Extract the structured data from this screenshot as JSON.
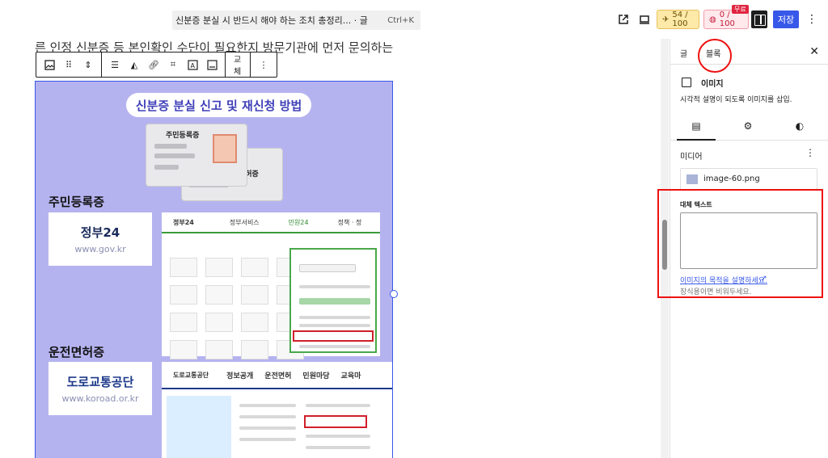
{
  "topbar": {
    "command_title": "신분증 분실 시 반드시 해야 하는 조치 총정리... · 글",
    "command_shortcut": "Ctrl+K",
    "seo_score": "54 / 100",
    "ai_count": "0 / 100",
    "free_badge": "무료",
    "save_label": "저장"
  },
  "editor": {
    "paragraph_text": "른 인정 신분증 등 본인확인 수단이 필요한지 방문기관에 먼저 문의하는",
    "toolbar_replace": "교체"
  },
  "image": {
    "title": "신분증 분실 신고 및 재신청 방법",
    "card_front_label": "주민등록증",
    "card_back_label": "면허증",
    "section1": "주민등록증",
    "gov_logo": "정부24",
    "gov_url": "www.gov.kr",
    "gov_site_logo": "정부24",
    "gov_nav": [
      "정부서비스",
      "민원24",
      "정책 · 정"
    ],
    "section2": "운전면허증",
    "koroad_logo": "도로교통공단",
    "koroad_url": "www.koroad.or.kr",
    "koroad_site_logo": "도로교통공단",
    "koroad_nav": [
      "정보공개",
      "운전면허",
      "민원마당",
      "교육마"
    ]
  },
  "sidebar": {
    "tab_post": "글",
    "tab_block": "블록",
    "block_name": "이미지",
    "block_desc": "시각적 설명이 되도록 이미지를 삽입.",
    "media_section": "미디어",
    "media_file": "image-60.png",
    "alt_label": "대체 텍스트",
    "alt_value": "",
    "alt_link": "이미지의 목적을 설명하세요.",
    "alt_help": "장식용이면 비워두세요."
  }
}
